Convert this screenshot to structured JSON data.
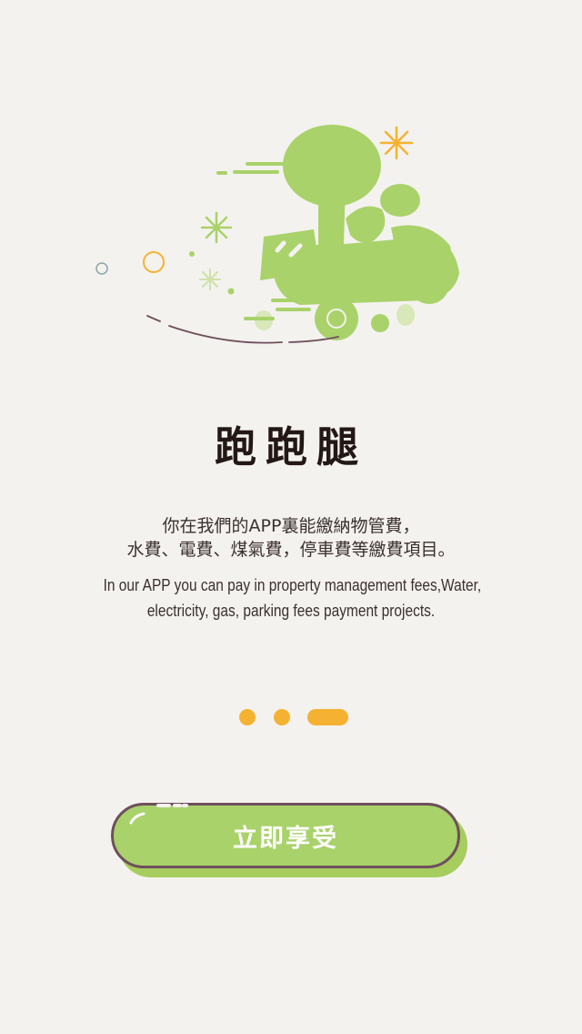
{
  "illustration": {
    "icon": "delivery-scooter-illustration"
  },
  "title": "跑跑腿",
  "description_zh": [
    "你在我們的APP裏能繳納物管費，",
    "水費、電費、煤氣費，停車費等繳費項目。"
  ],
  "description_en": [
    "In our APP you can pay in property management fees,Water,",
    "electricity, gas, parking fees payment projects."
  ],
  "pagination": {
    "total": 3,
    "active": 3
  },
  "cta_button": {
    "label": "立即享受"
  },
  "colors": {
    "accent_green": "#a9d26a",
    "dot_orange": "#f5b232",
    "border": "#6e4f5c",
    "background": "#f4f2ee"
  }
}
